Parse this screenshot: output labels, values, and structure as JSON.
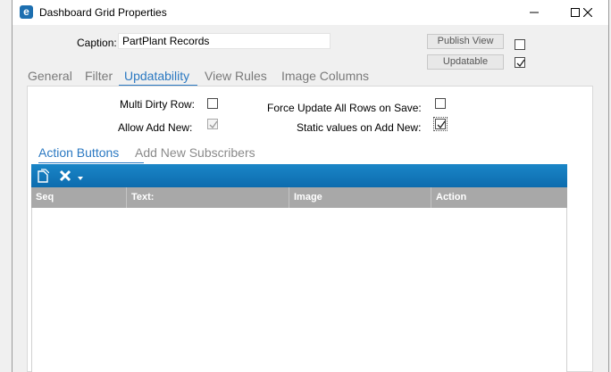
{
  "window": {
    "app_icon_letter": "e",
    "title": "Dashboard Grid Properties",
    "controls": [
      "minimize-icon",
      "maximize-icon",
      "close-icon"
    ]
  },
  "caption": {
    "label": "Caption:",
    "value": "PartPlant Records"
  },
  "buttons": {
    "publish_view": "Publish View",
    "updatable": "Updatable",
    "publish_view_checked": false,
    "updatable_checked": true
  },
  "tabs": [
    {
      "label": "General",
      "active": false
    },
    {
      "label": "Filter",
      "active": false
    },
    {
      "label": "Updatability",
      "active": true
    },
    {
      "label": "View Rules",
      "active": false
    },
    {
      "label": "Image Columns",
      "active": false
    }
  ],
  "options": {
    "multi_dirty_row": {
      "label": "Multi Dirty Row:",
      "checked": false
    },
    "allow_add_new": {
      "label": "Allow Add New:",
      "checked": true,
      "disabled": true
    },
    "force_update": {
      "label": "Force Update All Rows on Save:",
      "checked": false
    },
    "static_values": {
      "label": "Static values on Add New:",
      "checked": true
    }
  },
  "subtabs": [
    {
      "label": "Action Buttons",
      "active": true
    },
    {
      "label": "Add New Subscribers",
      "active": false
    }
  ],
  "toolbar": {
    "icons": [
      "new-icon",
      "delete-icon",
      "dropdown-arrow-icon"
    ]
  },
  "grid": {
    "columns": [
      "Seq",
      "Text:",
      "Image",
      "Action"
    ],
    "rows": []
  },
  "colors": {
    "accent": "#2b79c2",
    "toolbar": "#1479bb",
    "grid_header": "#a8a8a8"
  }
}
